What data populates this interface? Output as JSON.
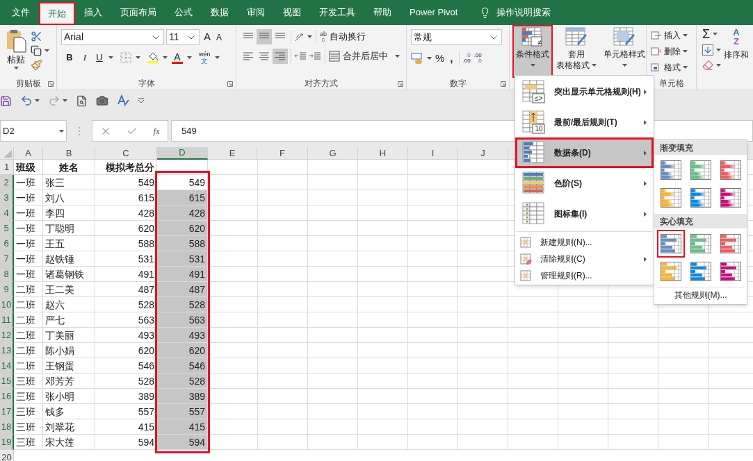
{
  "tabs": [
    {
      "label": "文件",
      "selected": false,
      "highlighted": false
    },
    {
      "label": "开始",
      "selected": true,
      "highlighted": true
    },
    {
      "label": "插入",
      "selected": false,
      "highlighted": false
    },
    {
      "label": "页面布局",
      "selected": false,
      "highlighted": false
    },
    {
      "label": "公式",
      "selected": false,
      "highlighted": false
    },
    {
      "label": "数据",
      "selected": false,
      "highlighted": false
    },
    {
      "label": "审阅",
      "selected": false,
      "highlighted": false
    },
    {
      "label": "视图",
      "selected": false,
      "highlighted": false
    },
    {
      "label": "开发工具",
      "selected": false,
      "highlighted": false
    },
    {
      "label": "帮助",
      "selected": false,
      "highlighted": false
    },
    {
      "label": "Power Pivot",
      "selected": false,
      "highlighted": false
    }
  ],
  "tell_me": "操作说明搜索",
  "ribbon": {
    "clipboard": {
      "paste": "粘贴",
      "label": "剪贴板"
    },
    "font": {
      "name": "Arial",
      "size": "11",
      "grow": "A",
      "shrink": "A",
      "bold": "B",
      "italic": "I",
      "underline": "U",
      "color_glyph": "A",
      "phonetic_top": "wén",
      "phonetic_bottom": "文",
      "label": "字体"
    },
    "alignment": {
      "wrap_top": "ab",
      "wrap_bottom": "c",
      "wrap": "自动换行",
      "merge": "合并后居中",
      "label": "对齐方式"
    },
    "number": {
      "format": "常规",
      "percent": "%",
      "comma": ",",
      "increase_decimal": [
        ".0",
        ".00"
      ],
      "decrease_decimal": [
        ".00",
        ".0"
      ],
      "label": "数字"
    },
    "styles": [
      {
        "kind": "conditional",
        "lines": [
          "条件格式"
        ],
        "icon_text": "≠",
        "selected": true,
        "highlighted": true
      },
      {
        "kind": "table",
        "lines": [
          "套用",
          "表格格式"
        ],
        "selected": false,
        "highlighted": false
      },
      {
        "kind": "cellstyle",
        "lines": [
          "单元格样式"
        ],
        "selected": false,
        "highlighted": false
      }
    ],
    "cells": {
      "items": [
        {
          "kind": "insert",
          "label": "插入"
        },
        {
          "kind": "delete",
          "label": "删除"
        },
        {
          "kind": "format",
          "label": "格式"
        }
      ],
      "label": "单元格"
    },
    "editing": {
      "sum": "Σ",
      "sort_glyphs": [
        "A",
        "Z"
      ],
      "sort": "排序和"
    }
  },
  "name_box": "D2",
  "fx": "fx",
  "formula": "549",
  "sheet": {
    "columns": [
      {
        "label": "A",
        "selected": false
      },
      {
        "label": "B",
        "selected": false
      },
      {
        "label": "C",
        "selected": false
      },
      {
        "label": "D",
        "selected": true
      },
      {
        "label": "E",
        "selected": false
      },
      {
        "label": "F",
        "selected": false
      },
      {
        "label": "G",
        "selected": false
      },
      {
        "label": "H",
        "selected": false
      },
      {
        "label": "I",
        "selected": false
      },
      {
        "label": "J",
        "selected": false
      }
    ],
    "header": {
      "number": "1",
      "selected": false,
      "cells": [
        "班级",
        "姓名",
        "模拟考总分"
      ]
    },
    "rows": [
      {
        "number": "2",
        "selected": true,
        "class": "一班",
        "name": "张三",
        "score": "549",
        "copy": "549",
        "active": true
      },
      {
        "number": "3",
        "selected": true,
        "class": "一班",
        "name": "刘八",
        "score": "615",
        "copy": "615",
        "active": false
      },
      {
        "number": "4",
        "selected": true,
        "class": "一班",
        "name": "李四",
        "score": "428",
        "copy": "428",
        "active": false
      },
      {
        "number": "5",
        "selected": true,
        "class": "一班",
        "name": "丁聪明",
        "score": "620",
        "copy": "620",
        "active": false
      },
      {
        "number": "6",
        "selected": true,
        "class": "一班",
        "name": "王五",
        "score": "588",
        "copy": "588",
        "active": false
      },
      {
        "number": "7",
        "selected": true,
        "class": "一班",
        "name": "赵铁锤",
        "score": "531",
        "copy": "531",
        "active": false
      },
      {
        "number": "8",
        "selected": true,
        "class": "一班",
        "name": "诸葛钢铁",
        "score": "491",
        "copy": "491",
        "active": false
      },
      {
        "number": "9",
        "selected": true,
        "class": "二班",
        "name": "王二美",
        "score": "487",
        "copy": "487",
        "active": false
      },
      {
        "number": "10",
        "selected": true,
        "class": "二班",
        "name": "赵六",
        "score": "528",
        "copy": "528",
        "active": false
      },
      {
        "number": "11",
        "selected": true,
        "class": "二班",
        "name": "严七",
        "score": "563",
        "copy": "563",
        "active": false
      },
      {
        "number": "12",
        "selected": true,
        "class": "二班",
        "name": "丁美丽",
        "score": "493",
        "copy": "493",
        "active": false
      },
      {
        "number": "13",
        "selected": true,
        "class": "二班",
        "name": "陈小娟",
        "score": "620",
        "copy": "620",
        "active": false
      },
      {
        "number": "14",
        "selected": true,
        "class": "二班",
        "name": "王钢蛋",
        "score": "546",
        "copy": "546",
        "active": false
      },
      {
        "number": "15",
        "selected": true,
        "class": "三班",
        "name": "邓芳芳",
        "score": "528",
        "copy": "528",
        "active": false
      },
      {
        "number": "16",
        "selected": true,
        "class": "三班",
        "name": "张小明",
        "score": "389",
        "copy": "389",
        "active": false
      },
      {
        "number": "17",
        "selected": true,
        "class": "三班",
        "name": "钱多",
        "score": "557",
        "copy": "557",
        "active": false
      },
      {
        "number": "18",
        "selected": true,
        "class": "三班",
        "name": "刘翠花",
        "score": "415",
        "copy": "415",
        "active": false
      },
      {
        "number": "19",
        "selected": true,
        "class": "三班",
        "name": "宋大莲",
        "score": "594",
        "copy": "594",
        "active": false
      }
    ],
    "last_row": "20",
    "range_highlighted": true
  },
  "menu": {
    "items": [
      {
        "kind": "highlight",
        "label": "突出显示单元格规则(H)",
        "icon_text": "≤>",
        "submenu": true,
        "selected": false,
        "highlighted": false
      },
      {
        "kind": "topbottom",
        "label": "最前/最后规则(T)",
        "icon_text": "10",
        "submenu": true,
        "selected": false,
        "highlighted": false
      },
      {
        "kind": "databar",
        "label": "数据条(D)",
        "submenu": true,
        "selected": true,
        "highlighted": true
      },
      {
        "kind": "colorscale",
        "label": "色阶(S)",
        "submenu": true,
        "selected": false,
        "highlighted": false
      },
      {
        "kind": "iconset",
        "label": "图标集(I)",
        "submenu": true,
        "selected": false,
        "highlighted": false
      },
      {
        "kind": "new",
        "label": "新建规则(N)...",
        "submenu": false,
        "selected": false,
        "highlighted": false
      },
      {
        "kind": "clear",
        "label": "清除规则(C)",
        "submenu": true,
        "selected": false,
        "highlighted": false
      },
      {
        "kind": "manage",
        "label": "管理规则(R)...",
        "submenu": false,
        "selected": false,
        "highlighted": false
      }
    ]
  },
  "submenu": {
    "sections": [
      {
        "kind": "gradient",
        "title": "渐变填充",
        "options": [
          {
            "color": "#638ec6",
            "highlighted": false
          },
          {
            "color": "#63c384",
            "highlighted": false
          },
          {
            "color": "#ff555a",
            "highlighted": false
          },
          {
            "color": "#ffb628",
            "highlighted": false
          },
          {
            "color": "#008aef",
            "highlighted": false
          },
          {
            "color": "#d6007b",
            "highlighted": false
          }
        ]
      },
      {
        "kind": "solid",
        "title": "实心填充",
        "options": [
          {
            "color": "#638ec6",
            "highlighted": true
          },
          {
            "color": "#63c384",
            "highlighted": false
          },
          {
            "color": "#ff555a",
            "highlighted": false
          },
          {
            "color": "#ffb628",
            "highlighted": false
          },
          {
            "color": "#008aef",
            "highlighted": false
          },
          {
            "color": "#d6007b",
            "highlighted": false
          }
        ]
      }
    ],
    "more": "其他规则(M)..."
  }
}
